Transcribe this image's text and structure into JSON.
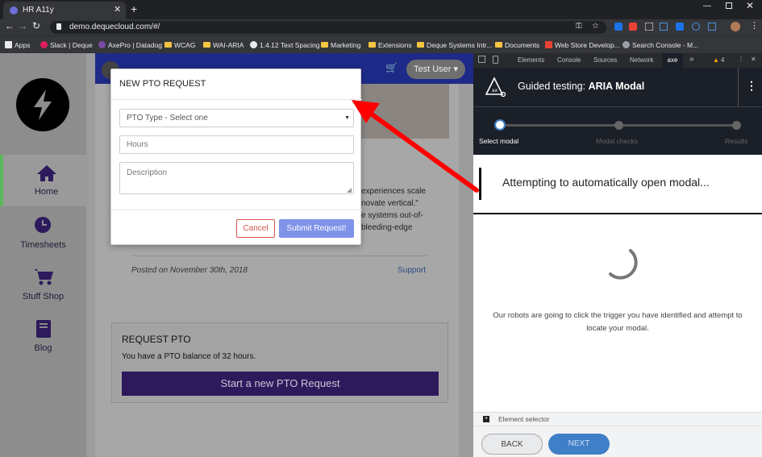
{
  "browser": {
    "tab_title": "HR A11y",
    "url": "demo.dequecloud.com/#/",
    "bookmarks": [
      "Apps",
      "Slack | Deque",
      "AxePro | Datadog",
      "WCAG",
      "WAI-ARIA",
      "1.4.12 Text Spacing",
      "Marketing",
      "Extensions",
      "Deque Systems Intr...",
      "Documents",
      "Web Store Develop...",
      "Search Console - M..."
    ],
    "window_controls": [
      "minimize-icon",
      "maximize-icon",
      "close-icon"
    ]
  },
  "app": {
    "user_menu": "Test User",
    "nav": [
      {
        "label": "Home",
        "icon": "home-icon"
      },
      {
        "label": "Timesheets",
        "icon": "clock-icon"
      },
      {
        "label": "Stuff Shop",
        "icon": "cart-icon"
      },
      {
        "label": "Blog",
        "icon": "book-icon"
      }
    ],
    "article_lines": [
      "experiences scale",
      "novate vertical.\"",
      "e systems out-of-",
      "bleeding-edge"
    ],
    "posted": "Posted on November 30th, 2018",
    "support_link": "Support",
    "request": {
      "title": "REQUEST PTO",
      "balance": "You have a PTO balance of 32 hours.",
      "start_button": "Start a new PTO Request"
    }
  },
  "modal": {
    "title": "NEW PTO REQUEST",
    "pto_type": "PTO Type - Select one",
    "hours_placeholder": "Hours",
    "description_placeholder": "Description",
    "cancel": "Cancel",
    "submit": "Submit Request!"
  },
  "devtools": {
    "tabs": [
      "Elements",
      "Console",
      "Sources",
      "Network",
      "axe"
    ],
    "warning_count": "4",
    "heading_prefix": "Guided testing: ",
    "heading_bold": "ARIA Modal",
    "steps": [
      "Select modal",
      "Modal checks",
      "Results"
    ],
    "current_step": 1,
    "status": "Attempting to automatically open modal...",
    "message_line1": "Our robots are going to click the trigger you have identified and attempt to",
    "message_line2": "locate your modal.",
    "element_selector": "Element selector",
    "back": "BACK",
    "next": "NEXT"
  },
  "colors": {
    "nav_active_accent": "#5cb85c",
    "primary_purple": "#2c1a5c",
    "submit_blue": "#7f93e8",
    "cancel_red": "#d9534f",
    "next_blue": "#3f7fc7",
    "annotation_arrow": "#ff0000"
  }
}
